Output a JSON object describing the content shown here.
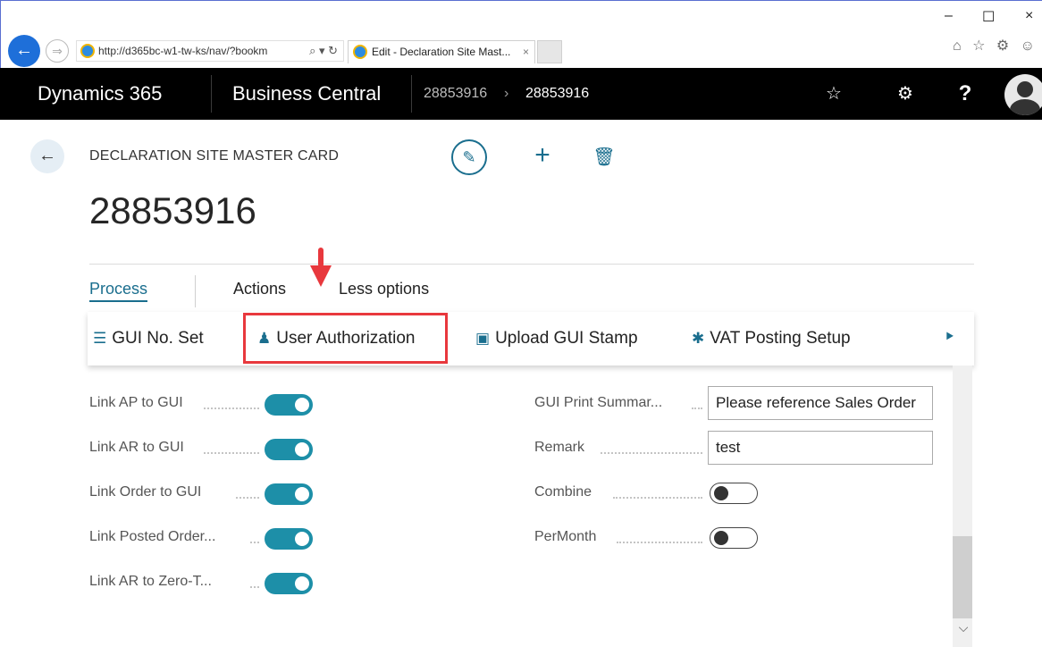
{
  "browser": {
    "address_url": "http://d365bc-w1-tw-ks/nav/?bookm",
    "address_tools": "⌕ ▾ ↻",
    "tab_title": "Edit - Declaration Site Mast...",
    "tab_close": "×",
    "back_icon": "back-arrow-icon",
    "window_controls": {
      "minimize": "–",
      "maximize": "☐",
      "close": "×"
    },
    "toolbar_icons": "⌂ ☆ ⚙ ☺"
  },
  "header": {
    "product": "Dynamics 365",
    "app": "Business Central",
    "breadcrumb": [
      "28853916",
      "28853916"
    ],
    "breadcrumb_sep": "›",
    "icons": {
      "lightbulb": "☆",
      "settings": "⚙",
      "help": "?"
    }
  },
  "page": {
    "caption": "DECLARATION SITE MASTER CARD",
    "title": "28853916",
    "back": "←",
    "edit_icon": "✎",
    "new_icon": "+",
    "delete_icon": "🗑"
  },
  "menu": {
    "tabs": [
      {
        "label": "Process",
        "active": true
      },
      {
        "label": "Actions",
        "active": false
      },
      {
        "label": "Less options",
        "active": false
      }
    ]
  },
  "ribbon": {
    "items": [
      {
        "label": "GUI No. Set",
        "icon": "☰"
      },
      {
        "label": "User Authorization",
        "icon": "♟"
      },
      {
        "label": "Upload GUI Stamp",
        "icon": "▣"
      },
      {
        "label": "VAT Posting Setup",
        "icon": "✱"
      }
    ],
    "pin_icon": "⯈"
  },
  "fields_left": [
    {
      "label": "Link AP to GUI",
      "value": true
    },
    {
      "label": "Link AR to GUI",
      "value": true
    },
    {
      "label": "Link Order to GUI",
      "value": true
    },
    {
      "label": "Link Posted Order...",
      "value": true
    },
    {
      "label": "Link AR to Zero-T...",
      "value": true
    }
  ],
  "fields_right": [
    {
      "label": "GUI Print Summar...",
      "value": "Please reference Sales Order"
    },
    {
      "label": "Remark",
      "value": "test"
    },
    {
      "label": "Combine",
      "value": false
    },
    {
      "label": "PerMonth",
      "value": false
    }
  ],
  "scroll": {
    "down_icon": "⌵"
  },
  "colors": {
    "accent": "#1a6e8e",
    "toggle_on": "#1d8fa8",
    "highlight": "#e8383d",
    "header_bg": "#000000"
  }
}
